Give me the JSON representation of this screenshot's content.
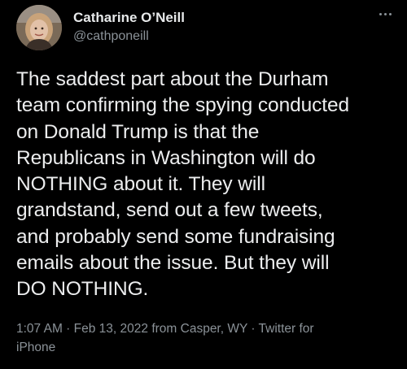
{
  "author": {
    "display_name": "Catharine O’Neill",
    "handle": "@cathponeill"
  },
  "more_icon": "more-horizontal-icon",
  "tweet": {
    "lines": [
      "The saddest part about the Durham",
      "team confirming the spying conducted",
      "on Donald Trump is that the",
      "Republicans in Washington will do",
      "NOTHING about it. They will",
      "grandstand, send out a few tweets,",
      "and probably send some fundraising",
      "emails about the issue. But they will",
      "DO NOTHING."
    ]
  },
  "meta": {
    "time": "1:07 AM",
    "sep1": " · ",
    "date": "Feb 13, 2022",
    "location": " from Casper, WY",
    "sep2": " · ",
    "client_a": "Twitter for",
    "client_b": "iPhone"
  },
  "colors": {
    "background": "#000000",
    "primary_text": "#e7e9ea",
    "secondary_text": "#8b9298"
  }
}
